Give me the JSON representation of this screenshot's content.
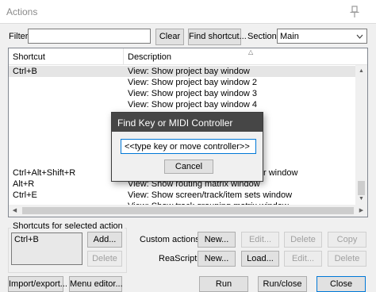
{
  "window": {
    "title": "Actions"
  },
  "toolbar": {
    "filter_label": "Filter:",
    "filter_value": "",
    "clear_label": "Clear",
    "find_shortcut_label": "Find shortcut...",
    "section_label": "Section:",
    "section_value": "Main"
  },
  "list": {
    "columns": [
      "Shortcut",
      "Description"
    ],
    "rows": [
      {
        "shortcut": "Ctrl+B",
        "description": "View: Show project bay window",
        "selected": true
      },
      {
        "shortcut": "",
        "description": "View: Show project bay window 2"
      },
      {
        "shortcut": "",
        "description": "View: Show project bay window 3"
      },
      {
        "shortcut": "",
        "description": "View: Show project bay window 4"
      },
      {
        "shortcut": "Ctrl+Alt+Shift+R",
        "description": "View: Show region/marker manager window"
      },
      {
        "shortcut": "Alt+R",
        "description": "View: Show routing matrix window"
      },
      {
        "shortcut": "Ctrl+E",
        "description": "View: Show screen/track/item sets window"
      },
      {
        "shortcut": "",
        "description": "View: Show track grouping matrix window"
      }
    ]
  },
  "shortcuts": {
    "group_label": "Shortcuts for selected action",
    "items": [
      "Ctrl+B"
    ],
    "add_label": "Add...",
    "delete_label": "Delete"
  },
  "custom_actions": {
    "label": "Custom actions:",
    "new_label": "New...",
    "edit_label": "Edit...",
    "delete_label": "Delete",
    "copy_label": "Copy"
  },
  "reascript": {
    "label": "ReaScript:",
    "new_label": "New...",
    "load_label": "Load...",
    "edit_label": "Edit...",
    "delete_label": "Delete"
  },
  "footer": {
    "import_export_label": "Import/export...",
    "menu_editor_label": "Menu editor...",
    "run_label": "Run",
    "run_close_label": "Run/close",
    "close_label": "Close"
  },
  "dialog": {
    "title": "Find Key or MIDI Controller",
    "input_value": "<<type key or move controller>>",
    "cancel_label": "Cancel"
  }
}
